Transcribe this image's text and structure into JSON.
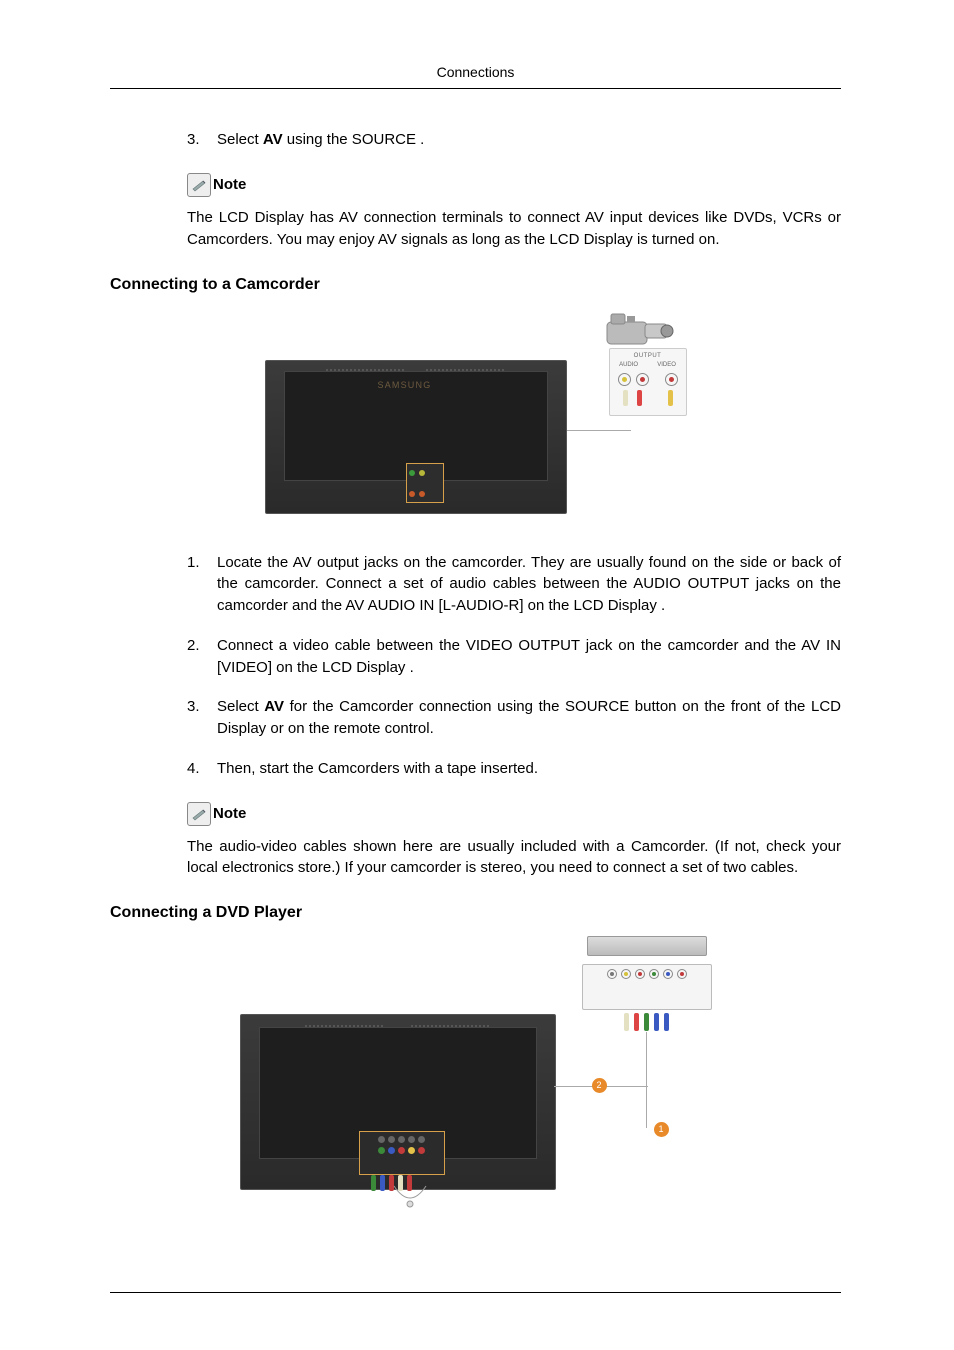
{
  "header": {
    "title": "Connections"
  },
  "intro_list": {
    "items": [
      {
        "num": "3.",
        "prefix": "Select ",
        "bold": "AV",
        "suffix": " using the SOURCE ."
      }
    ]
  },
  "note1": {
    "label": "Note",
    "text": "The LCD Display has AV connection terminals to connect AV input devices like DVDs, VCRs or Camcorders. You may enjoy AV signals as long as the LCD Display is turned on."
  },
  "section_camcorder": {
    "heading": "Connecting to a Camcorder",
    "figure": {
      "output_label": "OUTPUT",
      "audio_label": "AUDIO",
      "video_label": "VIDEO",
      "brand": "SAMSUNG"
    },
    "items": [
      {
        "num": "1.",
        "text": "Locate the AV output jacks on the camcorder. They are usually found on the side or back of the camcorder. Connect a set of audio cables between the AUDIO OUTPUT jacks on the camcorder and the AV AUDIO IN [L-AUDIO-R] on the LCD Display ."
      },
      {
        "num": "2.",
        "text": "Connect a video cable between the VIDEO OUTPUT jack on the camcorder and the AV IN [VIDEO] on the LCD Display ."
      },
      {
        "num": "3.",
        "prefix": "Select ",
        "bold": "AV",
        "suffix": " for the Camcorder connection using the SOURCE button on the front of the LCD Display or on the remote control."
      },
      {
        "num": "4.",
        "text": "Then, start the Camcorders with a tape inserted."
      }
    ]
  },
  "note2": {
    "label": "Note",
    "text": "The audio-video cables shown here are usually included with a Camcorder. (If not, check your local electronics store.) If your camcorder is stereo, you need to connect a set of two cables."
  },
  "section_dvd": {
    "heading": "Connecting a DVD Player",
    "badges": {
      "one": "1",
      "two": "2"
    }
  }
}
